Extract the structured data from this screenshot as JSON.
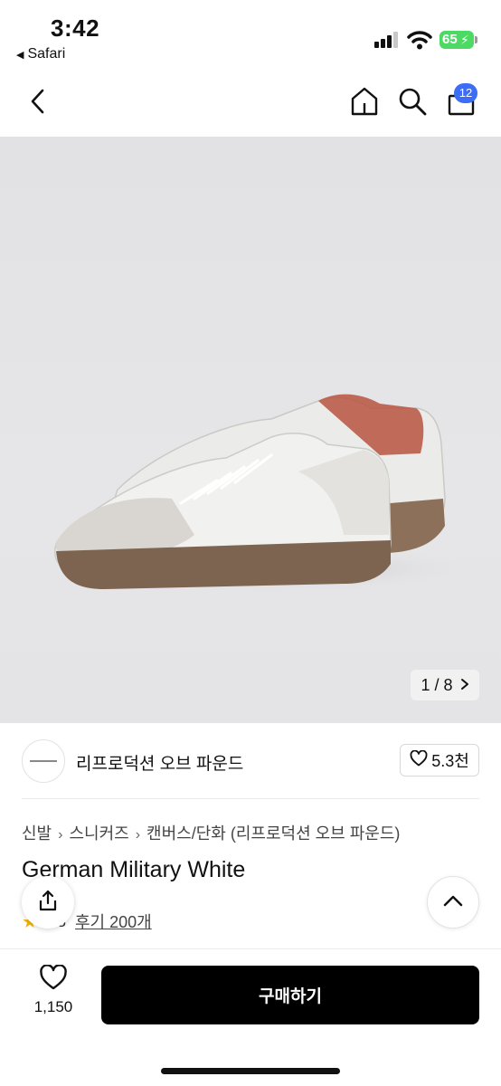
{
  "status_bar": {
    "time": "3:42",
    "back_app": "Safari",
    "battery": "65"
  },
  "nav": {
    "back_icon": "chevron-left-icon",
    "home_icon": "home-icon",
    "search_icon": "search-icon",
    "cart_icon": "shopping-bag-icon",
    "cart_count": "12"
  },
  "gallery": {
    "counter": "1 / 8",
    "next_icon": "chevron-right-icon"
  },
  "brand": {
    "name": "리프로덕션 오브 파운드",
    "likes": "5.3천"
  },
  "breadcrumbs": [
    "신발",
    "스니커즈",
    "캔버스/단화 (리프로덕션 오브 파운드)"
  ],
  "product": {
    "title": "German Military White",
    "rating": "4.8",
    "reviews": "후기 200개"
  },
  "actions": {
    "wish_count": "1,150",
    "buy_label": "구매하기"
  },
  "colors": {
    "accent": "#3d6cf5",
    "buy_button": "#000000",
    "star": "#f4b400"
  }
}
